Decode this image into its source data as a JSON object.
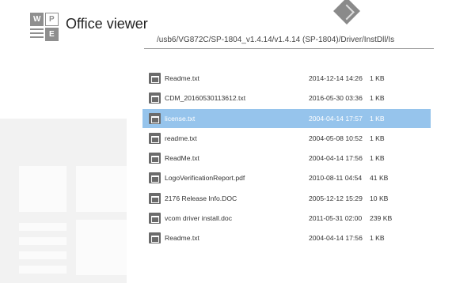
{
  "app": {
    "title": "Office viewer",
    "logo_letters": [
      "W",
      "P",
      "E"
    ]
  },
  "path": "/usb6/VG872C/SP-1804_v1.4.14/v1.4.14 (SP-1804)/Driver/InstDll/Is",
  "colors": {
    "selected_row": "#96c4ec",
    "icon": "#6b6b6b"
  },
  "files": [
    {
      "name": "Readme.txt",
      "date": "2014-12-14 14:26",
      "size": "1 KB"
    },
    {
      "name": "CDM_20160530113612.txt",
      "date": "2016-05-30 03:36",
      "size": "1 KB"
    },
    {
      "name": "license.txt",
      "date": "2004-04-14 17:57",
      "size": "1 KB",
      "selected": true
    },
    {
      "name": "readme.txt",
      "date": "2004-05-08 10:52",
      "size": "1 KB"
    },
    {
      "name": "ReadMe.txt",
      "date": "2004-04-14 17:56",
      "size": "1 KB"
    },
    {
      "name": "LogoVerificationReport.pdf",
      "date": "2010-08-11 04:54",
      "size": "41 KB"
    },
    {
      "name": "2176 Release Info.DOC",
      "date": "2005-12-12 15:29",
      "size": "10 KB"
    },
    {
      "name": "vcom driver install.doc",
      "date": "2011-05-31 02:00",
      "size": "239 KB"
    },
    {
      "name": "Readme.txt",
      "date": "2004-04-14 17:56",
      "size": "1 KB"
    }
  ]
}
